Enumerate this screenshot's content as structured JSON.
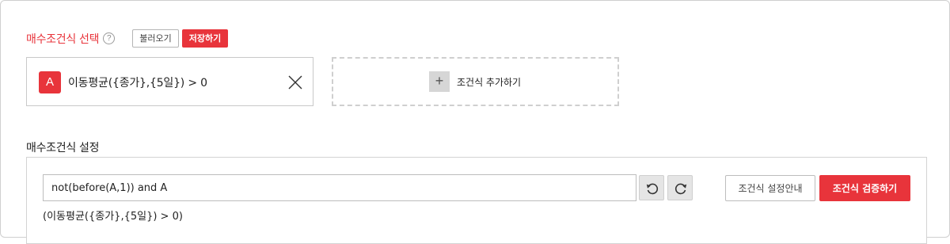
{
  "buy_condition": {
    "title": "매수조건식 선택",
    "help_glyph": "?",
    "load_label": "불러오기",
    "save_label": "저장하기",
    "conditions": [
      {
        "badge": "A",
        "text": "이동평균({종가},{5일}) > 0"
      }
    ],
    "add_glyph": "+",
    "add_label": "조건식 추가하기"
  },
  "settings": {
    "title": "매수조건식 설정",
    "expression_value": "not(before(A,1)) and A",
    "expression_preview": "(이동평균({종가},{5일}) > 0)",
    "guide_label": "조건식 설정안내",
    "verify_label": "조건식 검증하기"
  },
  "colors": {
    "accent": "#e8343b",
    "border": "#c9c9c9",
    "plus_bg": "#d6d6d6",
    "icon_btn_bg": "#e5e5e5"
  }
}
